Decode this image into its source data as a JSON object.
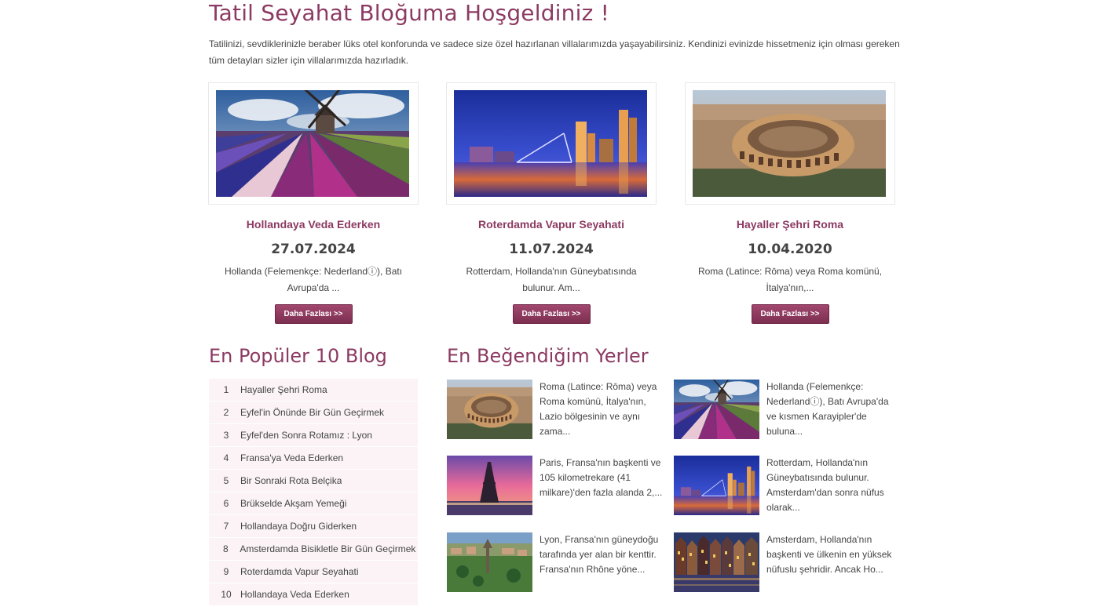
{
  "page": {
    "title": "Tatil Seyahat Bloğuma Hoşgeldiniz !",
    "intro": "Tatilinizi, sevdiklerinizle beraber lüks otel konforunda ve sadece size özel hazırlanan villalarımızda yaşayabilirsiniz. Kendinizi evinizde hissetmeniz için olması gereken tüm detayları sizler için villalarımızda hazırladık."
  },
  "cards": [
    {
      "title": "Hollandaya Veda Ederken",
      "date": "27.07.2024",
      "desc": "Hollanda (Felemenkçe: Nederlandⓘ), Batı Avrupa'da ...",
      "button": "Daha Fazlası >>",
      "image": "windmill-tulip-field"
    },
    {
      "title": "Roterdamda Vapur Seyahati",
      "date": "11.07.2024",
      "desc": "Rotterdam, Hollanda'nın Güneybatısında bulunur. Am...",
      "button": "Daha Fazlası >>",
      "image": "rotterdam-night-skyline"
    },
    {
      "title": "Hayaller Şehri Roma",
      "date": "10.04.2020",
      "desc": "Roma (Latince: Rōma) veya Roma komünü, İtalya'nın,...",
      "button": "Daha Fazlası >>",
      "image": "colosseum-aerial"
    }
  ],
  "popular": {
    "heading": "En Popüler 10 Blog",
    "items": [
      {
        "n": "1",
        "label": "Hayaller Şehri Roma"
      },
      {
        "n": "2",
        "label": "Eyfel'in Önünde Bir Gün Geçirmek"
      },
      {
        "n": "3",
        "label": "Eyfel'den Sonra Rotamız : Lyon"
      },
      {
        "n": "4",
        "label": "Fransa'ya Veda Ederken"
      },
      {
        "n": "5",
        "label": "Bir Sonraki Rota Belçika"
      },
      {
        "n": "6",
        "label": "Brükselde Akşam Yemeği"
      },
      {
        "n": "7",
        "label": "Hollandaya Doğru Giderken"
      },
      {
        "n": "8",
        "label": "Amsterdamda Bisikletle Bir Gün Geçirmek -"
      },
      {
        "n": "9",
        "label": "Roterdamda Vapur Seyahati"
      },
      {
        "n": "10",
        "label": "Hollandaya Veda Ederken"
      }
    ]
  },
  "favorites": {
    "heading": "En Beğendiğim Yerler",
    "items": [
      {
        "text": "Roma (Latince: Rōma) veya Roma komünü, İtalya'nın, Lazio bölgesinin ve aynı zama...",
        "image": "colosseum"
      },
      {
        "text": "Hollanda (Felemenkçe: Nederlandⓘ), Batı Avrupa'da ve kısmen Karayipler'de buluna...",
        "image": "windmill-field"
      },
      {
        "text": "Paris, Fransa'nın başkenti ve 105 kilometrekare (41 milkare)'den fazla alanda 2,...",
        "image": "eiffel-sunset"
      },
      {
        "text": "Rotterdam, Hollanda'nın Güneybatısında bulunur. Amsterdam'dan sonra nüfus olarak...",
        "image": "rotterdam-night"
      },
      {
        "text": "Lyon, Fransa'nın güneydoğu tarafında yer alan bir kenttir. Fransa'nın Rhône yöne...",
        "image": "lyon-aerial"
      },
      {
        "text": "Amsterdam, Hollanda'nın başkenti ve ülkenin en yüksek nüfuslu şehridir. Ancak Ho...",
        "image": "amsterdam-canal-houses"
      }
    ]
  },
  "colors": {
    "accent": "#8c3a62",
    "button_top": "#a2486f",
    "button_bottom": "#7c2f50",
    "list_bg": "#fbf3f5"
  }
}
